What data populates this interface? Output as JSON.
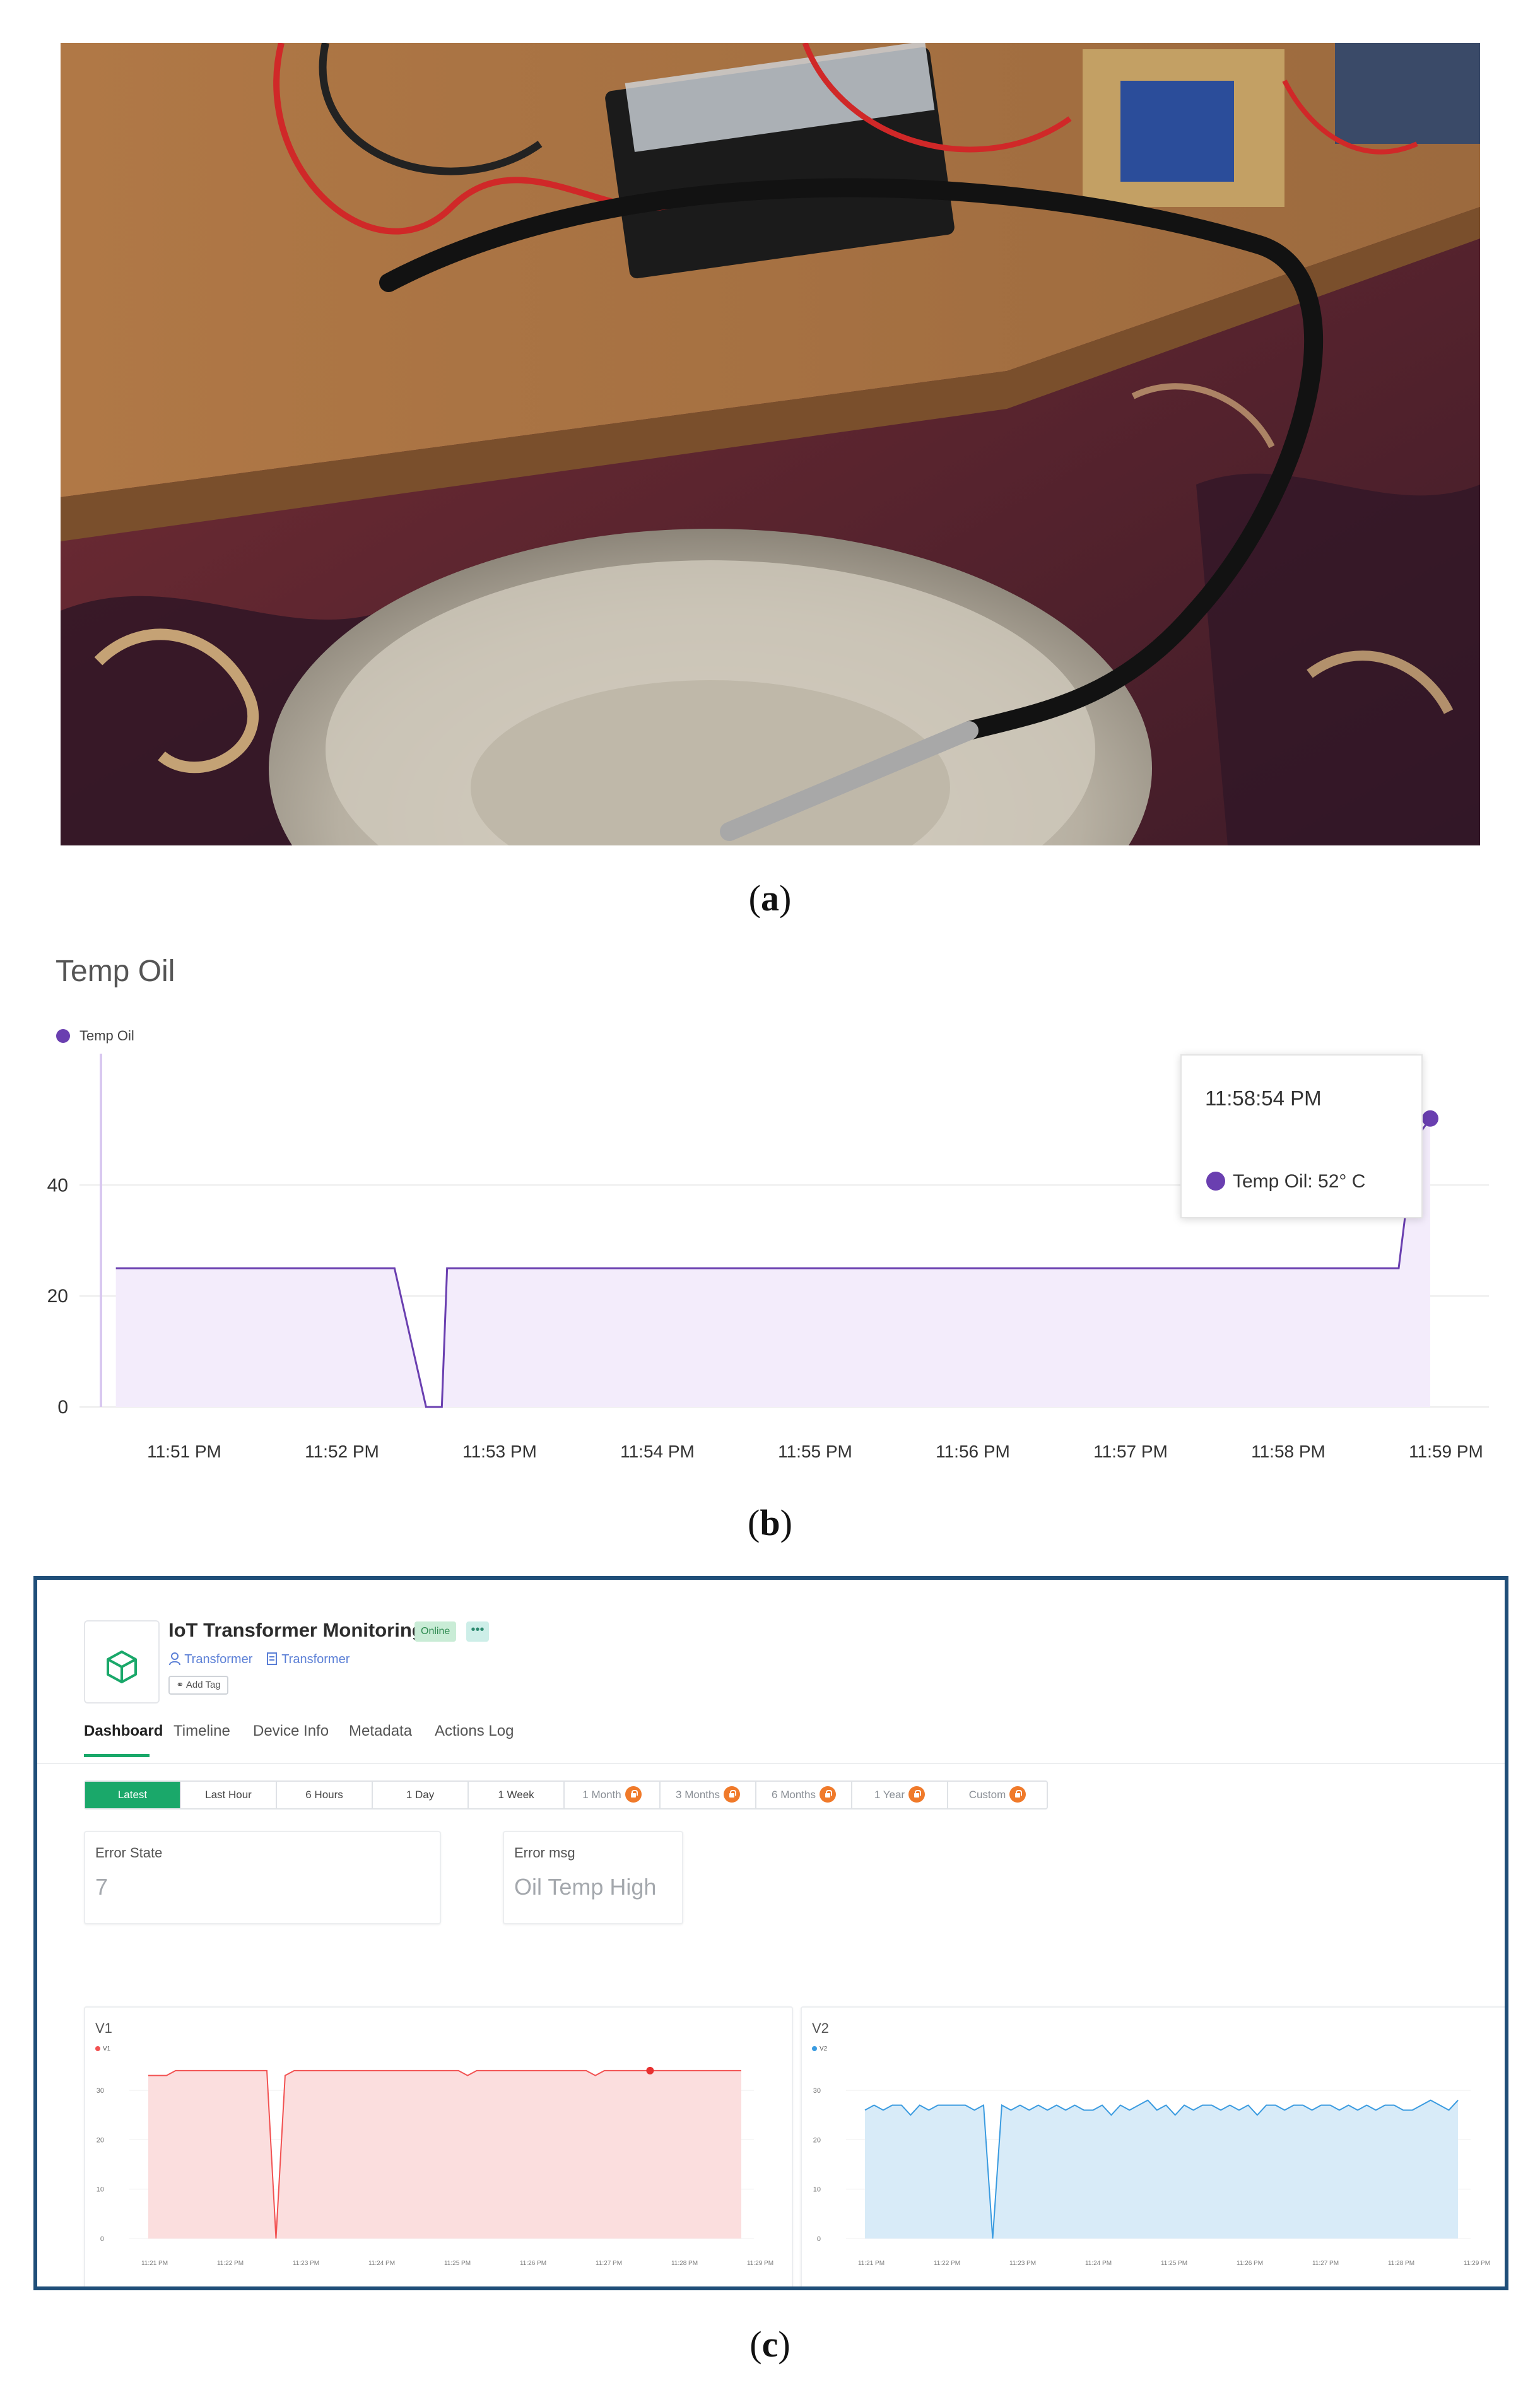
{
  "captions": {
    "a": "a",
    "b": "b",
    "c": "c"
  },
  "photo": {
    "description_icon": "photo-icon"
  },
  "temp_oil_chart": {
    "title": "Temp Oil",
    "legend": "Temp Oil",
    "tooltip_time": "11:58:54 PM",
    "tooltip_value": "Temp Oil: 52° C",
    "series_color": "#6a3fb0",
    "fill_color": "#f3ecfb"
  },
  "dashboard": {
    "device_name": "IoT Transformer Monitoring",
    "status_badge": "Online",
    "more_badge": "•••",
    "user_link": "Transformer",
    "template_link": "Transformer",
    "add_tag": "Add Tag",
    "tabs": [
      "Dashboard",
      "Timeline",
      "Device Info",
      "Metadata",
      "Actions Log"
    ],
    "ranges": [
      "Latest",
      "Last Hour",
      "6 Hours",
      "1 Day",
      "1 Week",
      "1 Month",
      "3 Months",
      "6 Months",
      "1 Year",
      "Custom"
    ],
    "error_state_label": "Error State",
    "error_state_value": "7",
    "error_msg_label": "Error msg",
    "error_msg_value": "Oil Temp High",
    "v1": {
      "title": "V1",
      "legend": "V1",
      "color": "#f25252",
      "fill": "#fbdede"
    },
    "v2": {
      "title": "V2",
      "legend": "V2",
      "color": "#3a9be0",
      "fill": "#d8ebf8"
    },
    "accent": "#1aa86a",
    "lock_color": "#f07a2a"
  },
  "chart_data": [
    {
      "type": "line",
      "title": "Temp Oil",
      "xlabel": "",
      "ylabel": "",
      "x_ticks": [
        "11:51 PM",
        "11:52 PM",
        "11:53 PM",
        "11:54 PM",
        "11:55 PM",
        "11:56 PM",
        "11:57 PM",
        "11:58 PM",
        "11:59 PM"
      ],
      "y_ticks": [
        0,
        20,
        40
      ],
      "ylim": [
        0,
        58
      ],
      "series": [
        {
          "name": "Temp Oil",
          "points": [
            [
              "11:50:34 PM",
              25
            ],
            [
              "11:52:20 PM",
              25
            ],
            [
              "11:52:32 PM",
              0
            ],
            [
              "11:52:38 PM",
              0
            ],
            [
              "11:52:40 PM",
              25
            ],
            [
              "11:58:42 PM",
              25
            ],
            [
              "11:58:48 PM",
              48
            ],
            [
              "11:58:54 PM",
              52
            ]
          ]
        }
      ],
      "grid": "horizontal",
      "legend_position": "top-left"
    },
    {
      "type": "area",
      "title": "V1",
      "x_ticks": [
        "11:21 PM",
        "11:22 PM",
        "11:23 PM",
        "11:24 PM",
        "11:25 PM",
        "11:26 PM",
        "11:27 PM",
        "11:28 PM",
        "11:29 PM"
      ],
      "y_ticks": [
        0,
        10,
        20,
        30
      ],
      "ylim": [
        0,
        35
      ],
      "series": [
        {
          "name": "V1",
          "values": [
            33,
            33,
            33,
            34,
            34,
            34,
            34,
            34,
            34,
            34,
            34,
            34,
            34,
            34,
            0,
            33,
            34,
            34,
            34,
            34,
            34,
            34,
            34,
            34,
            34,
            34,
            34,
            34,
            34,
            34,
            34,
            34,
            34,
            34,
            34,
            33,
            34,
            34,
            34,
            34,
            34,
            34,
            34,
            34,
            34,
            34,
            34,
            34,
            34,
            33,
            34,
            34,
            34,
            34,
            34,
            34,
            34,
            34,
            34,
            34,
            34,
            34,
            34,
            34,
            34,
            34
          ]
        }
      ],
      "legend_position": "top-left"
    },
    {
      "type": "area",
      "title": "V2",
      "x_ticks": [
        "11:21 PM",
        "11:22 PM",
        "11:23 PM",
        "11:24 PM",
        "11:25 PM",
        "11:26 PM",
        "11:27 PM",
        "11:28 PM",
        "11:29 PM"
      ],
      "y_ticks": [
        0,
        10,
        20,
        30
      ],
      "ylim": [
        0,
        35
      ],
      "series": [
        {
          "name": "V2",
          "values": [
            26,
            27,
            26,
            27,
            27,
            25,
            27,
            26,
            27,
            27,
            27,
            27,
            26,
            27,
            0,
            27,
            26,
            27,
            26,
            27,
            26,
            27,
            26,
            27,
            26,
            26,
            27,
            25,
            27,
            26,
            27,
            28,
            26,
            27,
            25,
            27,
            26,
            27,
            27,
            26,
            27,
            26,
            27,
            25,
            27,
            27,
            26,
            27,
            27,
            26,
            27,
            27,
            26,
            27,
            26,
            27,
            26,
            27,
            27,
            26,
            26,
            27,
            28,
            27,
            26,
            28
          ]
        }
      ],
      "legend_position": "top-left"
    }
  ]
}
